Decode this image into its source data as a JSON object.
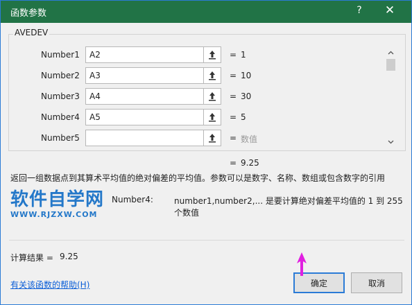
{
  "window": {
    "title": "函数参数",
    "help_label": "?",
    "close_label": "✕"
  },
  "function_name": "AVEDEV",
  "arguments": [
    {
      "label": "Number1",
      "value": "A2",
      "result": "1"
    },
    {
      "label": "Number2",
      "value": "A3",
      "result": "10"
    },
    {
      "label": "Number3",
      "value": "A4",
      "result": "30"
    },
    {
      "label": "Number4",
      "value": "A5",
      "result": "5"
    },
    {
      "label": "Number5",
      "value": "",
      "result": "数值"
    }
  ],
  "equals": "=",
  "formula_result": "9.25",
  "description": "返回一组数据点到其算术平均值的绝对偏差的平均值。参数可以是数字、名称、数组或包含数字的引用",
  "argument_help": {
    "name": "Number4:",
    "text": "number1,number2,... 是要计算绝对偏差平均值的 1 到 255 个数值"
  },
  "watermark": {
    "line1": "软件自学网",
    "line2": "WWW.RJZXW.COM"
  },
  "calc_result": {
    "label": "计算结果 =",
    "value": "9.25"
  },
  "help_link": "有关该函数的帮助(H)",
  "buttons": {
    "ok": "确定",
    "cancel": "取消"
  },
  "colors": {
    "titlebar": "#217346",
    "accent": "#2b7bd6",
    "watermark": "#2478c9",
    "pointer": "#e020e0"
  },
  "icons": {
    "ref_button": "collapse-dialog-icon",
    "pointer": "arrow-pointer-icon"
  }
}
